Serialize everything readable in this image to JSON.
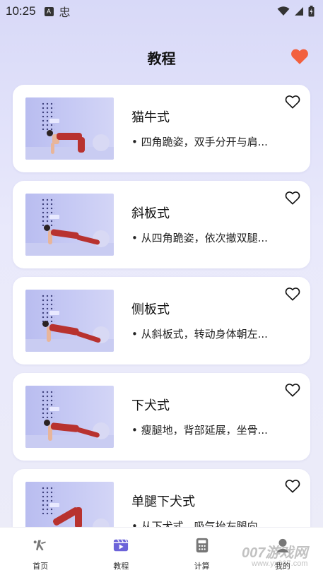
{
  "status_bar": {
    "time": "10:25",
    "icons": [
      "a-icon",
      "app-icon",
      "wifi-icon",
      "signal-icon",
      "battery-icon"
    ]
  },
  "header": {
    "title": "教程",
    "favorite_icon": "heart-filled-icon",
    "accent_color": "#f2603e"
  },
  "tutorials": [
    {
      "title": "猫牛式",
      "description": "• 四角跪姿，双手分开与肩...",
      "favorite": false
    },
    {
      "title": "斜板式",
      "description": "• 从四角跪姿，依次撤双腿...",
      "favorite": false
    },
    {
      "title": "侧板式",
      "description": "• 从斜板式，转动身体朝左...",
      "favorite": false
    },
    {
      "title": "下犬式",
      "description": "• 瘦腿地，背部延展，坐骨...",
      "favorite": false
    },
    {
      "title": "单腿下犬式",
      "description": "• 从下犬式，吸气抬左腿向",
      "favorite": false
    }
  ],
  "tabbar": {
    "items": [
      {
        "label": "首页",
        "icon": "yoga-figure-icon",
        "active": false
      },
      {
        "label": "教程",
        "icon": "video-icon",
        "active": true
      },
      {
        "label": "计算",
        "icon": "calculator-icon",
        "active": false
      },
      {
        "label": "我的",
        "icon": "user-icon",
        "active": false
      }
    ],
    "active_color": "#6c63d9"
  },
  "watermark": {
    "text": "007游戏网",
    "sub": "www.yx007.com"
  }
}
